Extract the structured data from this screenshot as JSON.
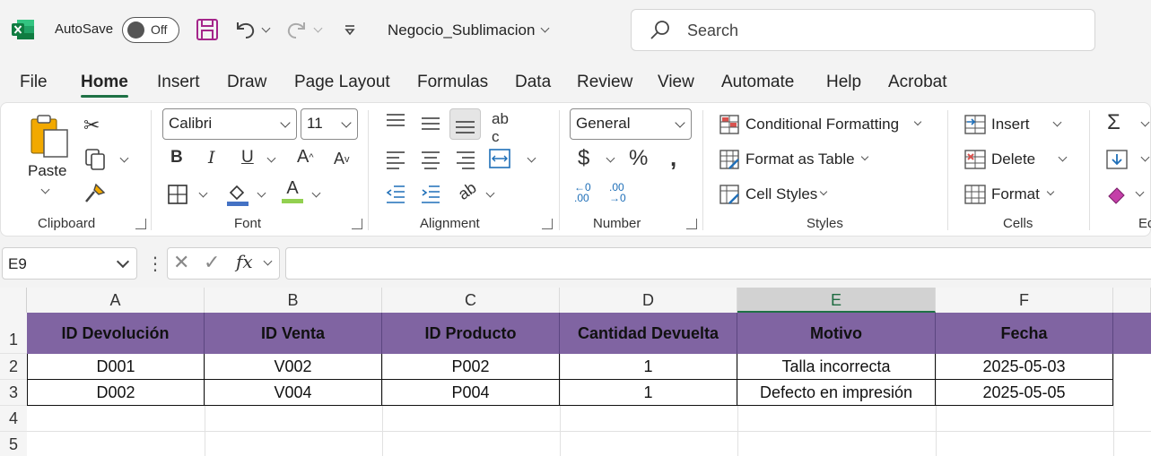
{
  "titlebar": {
    "autosave_label": "AutoSave",
    "toggle_state": "Off",
    "file_name": "Negocio_Sublimacion",
    "search_placeholder": "Search"
  },
  "tabs": [
    "File",
    "Home",
    "Insert",
    "Draw",
    "Page Layout",
    "Formulas",
    "Data",
    "Review",
    "View",
    "Automate",
    "Help",
    "Acrobat"
  ],
  "active_tab": "Home",
  "ribbon": {
    "clipboard": {
      "paste_label": "Paste",
      "group_label": "Clipboard"
    },
    "font": {
      "font_name": "Calibri",
      "font_size": "11",
      "group_label": "Font"
    },
    "alignment": {
      "group_label": "Alignment"
    },
    "number": {
      "format": "General",
      "group_label": "Number"
    },
    "styles": {
      "conditional_formatting": "Conditional Formatting",
      "format_as_table": "Format as Table",
      "cell_styles": "Cell Styles",
      "group_label": "Styles"
    },
    "cells": {
      "insert": "Insert",
      "delete": "Delete",
      "format": "Format",
      "group_label": "Cells"
    },
    "editing": {
      "group_label": "Ed"
    }
  },
  "formula_bar": {
    "name_box": "E9",
    "fx_label": "fx",
    "formula": ""
  },
  "sheet": {
    "columns": [
      "A",
      "B",
      "C",
      "D",
      "E",
      "F"
    ],
    "selected_column": "E",
    "rows": [
      "1",
      "2",
      "3",
      "4",
      "5"
    ],
    "header_row": [
      "ID Devolución",
      "ID Venta",
      "ID Producto",
      "Cantidad Devuelta",
      "Motivo",
      "Fecha"
    ],
    "data_rows": [
      [
        "D001",
        "V002",
        "P002",
        "1",
        "Talla incorrecta",
        "2025-05-03"
      ],
      [
        "D002",
        "V004",
        "P004",
        "1",
        "Defecto en impresión",
        "2025-05-05"
      ]
    ],
    "header_fill": "#8064a2"
  }
}
